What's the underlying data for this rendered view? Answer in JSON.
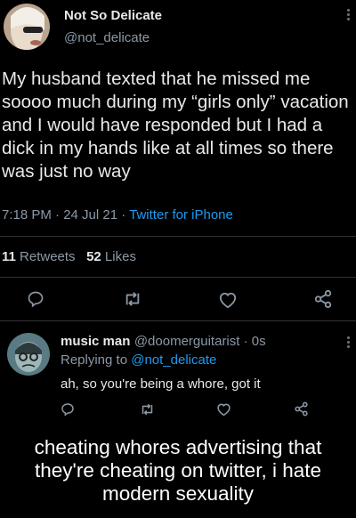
{
  "tweet": {
    "author_name": "Not So Delicate",
    "author_handle": "@not_delicate",
    "text": "My husband texted that he missed me soooo much during my “girls only” vacation and I would have responded but I had a dick in my hands like at all times so there was just no way",
    "time": "7:18 PM · 24 Jul 21 · ",
    "source": "Twitter for iPhone",
    "retweets_count": "11",
    "retweets_label": " Retweets",
    "likes_count": "52",
    "likes_label": " Likes"
  },
  "reply": {
    "author_name": "music man",
    "author_handle": "@doomerguitarist · 0s",
    "replying_prefix": "Replying to ",
    "replying_handle": "@not_delicate",
    "text": "ah, so you're being a whore, got it"
  },
  "caption": "cheating whores advertising that they're cheating on twitter, i hate modern sexuality",
  "icons": [
    "reply-icon",
    "retweet-icon",
    "like-icon",
    "share-icon",
    "more-icon"
  ],
  "colors": {
    "background": "#000000",
    "link": "#1d9bf0",
    "muted": "#8b98a5",
    "text": "#e7e9ea"
  }
}
